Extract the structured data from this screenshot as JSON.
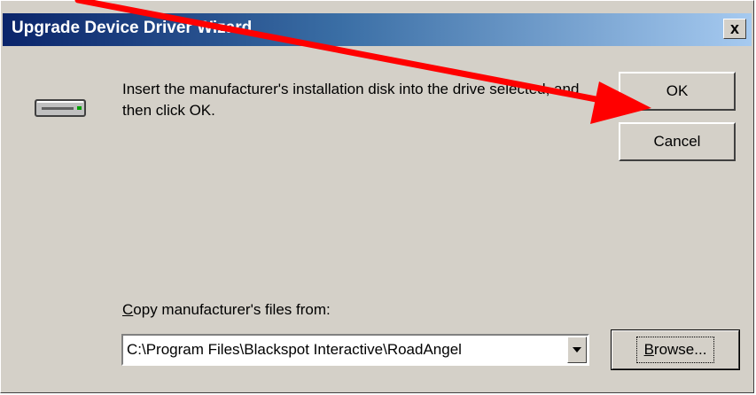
{
  "window": {
    "title": "Upgrade Device Driver Wizard",
    "close_glyph": "x"
  },
  "message": "Insert the manufacturer's installation disk into the drive selected, and then click OK.",
  "buttons": {
    "ok": "OK",
    "cancel": "Cancel",
    "browse_prefix": "B",
    "browse_rest": "rowse..."
  },
  "copy_from": {
    "label_prefix": "C",
    "label_rest": "opy manufacturer's files from:",
    "value": "C:\\Program Files\\Blackspot Interactive\\RoadAngel"
  },
  "icons": {
    "drive": "disk-drive-icon",
    "dropdown": "chevron-down-icon",
    "annotation": "red-arrow-annotation"
  },
  "colors": {
    "titlebar_start": "#0a246a",
    "titlebar_end": "#a6caf0",
    "dialog_bg": "#d4d0c8",
    "arrow": "#ff0000"
  }
}
